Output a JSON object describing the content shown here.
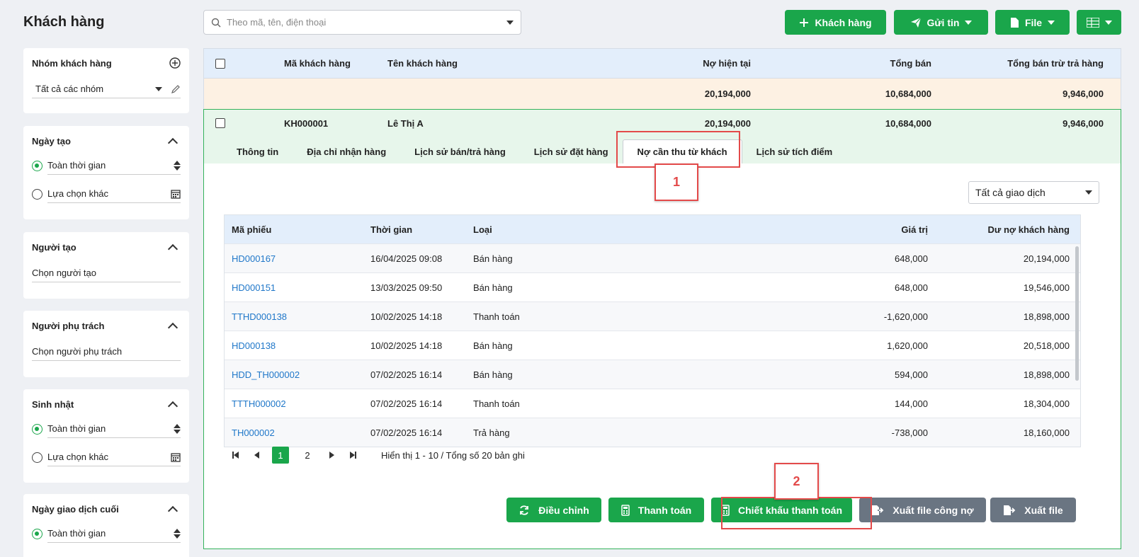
{
  "page": {
    "title": "Khách hàng"
  },
  "search": {
    "placeholder": "Theo mã, tên, điện thoại"
  },
  "toolbar": {
    "add_customer": "Khách hàng",
    "send_message": "Gửi tin",
    "file": "File"
  },
  "sidebar": {
    "group": {
      "title": "Nhóm khách hàng",
      "value": "Tất cả các nhóm"
    },
    "created_date": {
      "title": "Ngày tạo",
      "opt1": "Toàn thời gian",
      "opt2": "Lựa chọn khác"
    },
    "creator": {
      "title": "Người tạo",
      "placeholder": "Chọn người tạo"
    },
    "manager": {
      "title": "Người phụ trách",
      "placeholder": "Chọn người phụ trách"
    },
    "birthday": {
      "title": "Sinh nhật",
      "opt1": "Toàn thời gian",
      "opt2": "Lựa chọn khác"
    },
    "last_tx": {
      "title": "Ngày giao dịch cuối",
      "opt1": "Toàn thời gian"
    }
  },
  "table": {
    "headers": {
      "code": "Mã khách hàng",
      "name": "Tên khách hàng",
      "debt": "Nợ hiện tại",
      "sales": "Tổng bán",
      "net": "Tổng bán trừ trả hàng"
    },
    "summary": {
      "debt": "20,194,000",
      "sales": "10,684,000",
      "net": "9,946,000"
    },
    "row": {
      "code": "KH000001",
      "name": "Lê Thị A",
      "debt": "20,194,000",
      "sales": "10,684,000",
      "net": "9,946,000"
    }
  },
  "tabs": [
    "Thông tin",
    "Địa chỉ nhận hàng",
    "Lịch sử bán/trả hàng",
    "Lịch sử đặt hàng",
    "Nợ cần thu từ khách",
    "Lịch sử tích điểm"
  ],
  "filter": {
    "value": "Tất cả giao dịch"
  },
  "debt_table": {
    "headers": {
      "code": "Mã phiếu",
      "time": "Thời gian",
      "type": "Loại",
      "value": "Giá trị",
      "balance": "Dư nợ khách hàng"
    },
    "rows": [
      {
        "code": "HD000167",
        "time": "16/04/2025 09:08",
        "type": "Bán hàng",
        "value": "648,000",
        "balance": "20,194,000"
      },
      {
        "code": "HD000151",
        "time": "13/03/2025 09:50",
        "type": "Bán hàng",
        "value": "648,000",
        "balance": "19,546,000"
      },
      {
        "code": "TTHD000138",
        "time": "10/02/2025 14:18",
        "type": "Thanh toán",
        "value": "-1,620,000",
        "balance": "18,898,000"
      },
      {
        "code": "HD000138",
        "time": "10/02/2025 14:18",
        "type": "Bán hàng",
        "value": "1,620,000",
        "balance": "20,518,000"
      },
      {
        "code": "HDD_TH000002",
        "time": "07/02/2025 16:14",
        "type": "Bán hàng",
        "value": "594,000",
        "balance": "18,898,000"
      },
      {
        "code": "TTTH000002",
        "time": "07/02/2025 16:14",
        "type": "Thanh toán",
        "value": "144,000",
        "balance": "18,304,000"
      },
      {
        "code": "TH000002",
        "time": "07/02/2025 16:14",
        "type": "Trả hàng",
        "value": "-738,000",
        "balance": "18,160,000"
      }
    ]
  },
  "pagination": {
    "page1": "1",
    "page2": "2",
    "info": "Hiển thị 1 - 10 / Tổng số 20 bản ghi"
  },
  "actions": {
    "adjust": "Điều chỉnh",
    "pay": "Thanh toán",
    "discount": "Chiết khấu thanh toán",
    "export_debt": "Xuất file công nợ",
    "export": "Xuất file"
  },
  "callouts": {
    "one": "1",
    "two": "2"
  },
  "colors": {
    "accent": "#1aa64b",
    "link": "#1f77c9",
    "callout": "#e34a4a",
    "secondary": "#6a7582"
  }
}
